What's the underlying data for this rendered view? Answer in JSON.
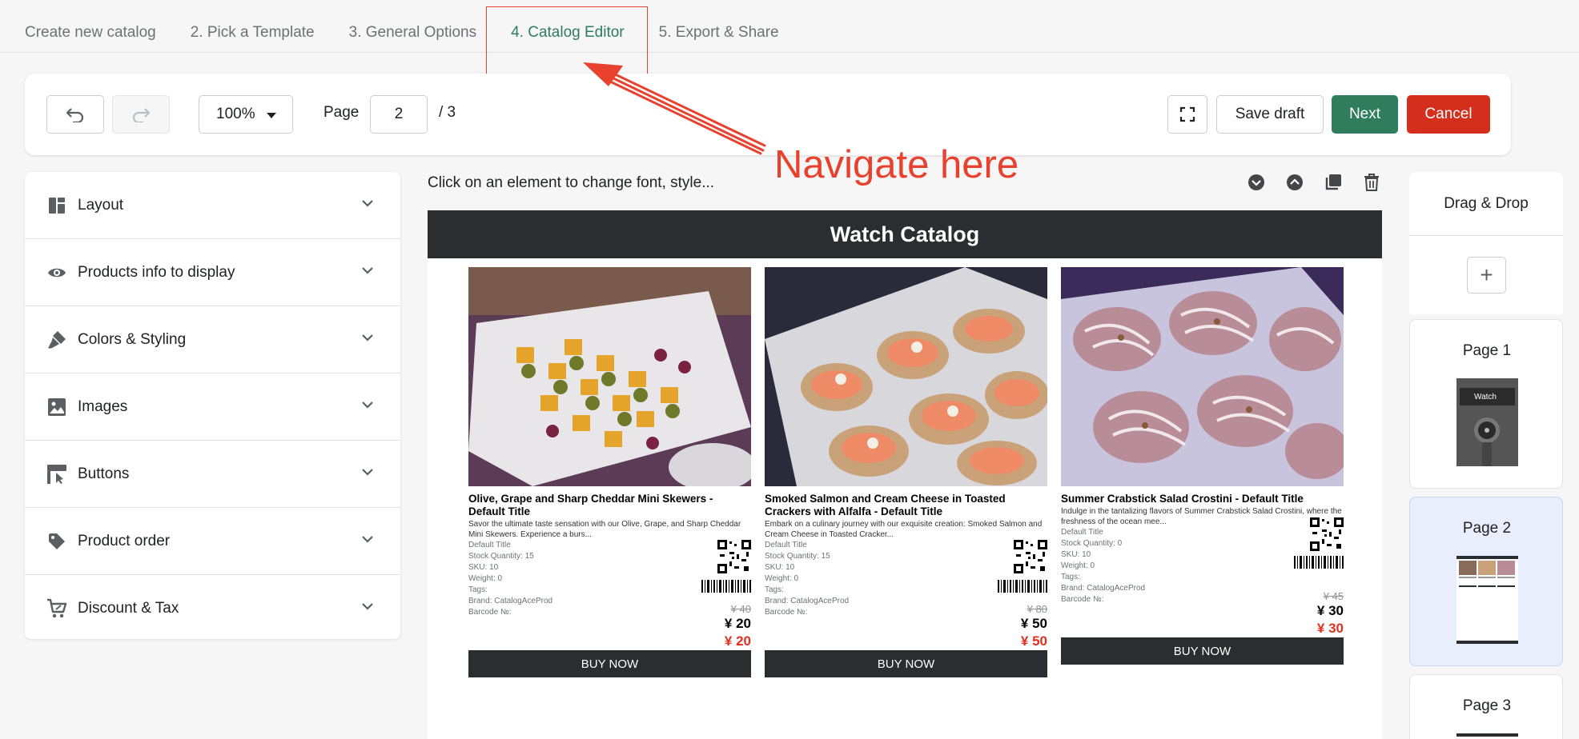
{
  "tabs": [
    {
      "label": "Create new catalog"
    },
    {
      "label": "2. Pick a Template"
    },
    {
      "label": "3. General Options"
    },
    {
      "label": "4. Catalog Editor"
    },
    {
      "label": "5. Export & Share"
    }
  ],
  "active_tab_index": 3,
  "toolbar": {
    "zoom": "100%",
    "page_label": "Page",
    "page_value": "2",
    "page_total": "/ 3",
    "save_draft": "Save draft",
    "next": "Next",
    "cancel": "Cancel"
  },
  "annotation": {
    "text": "Navigate here",
    "color": "#e8412e"
  },
  "sidebar": {
    "items": [
      {
        "label": "Layout",
        "icon": "layout-icon"
      },
      {
        "label": "Products info to display",
        "icon": "eye-icon"
      },
      {
        "label": "Colors & Styling",
        "icon": "paint-brush-icon"
      },
      {
        "label": "Images",
        "icon": "image-icon"
      },
      {
        "label": "Buttons",
        "icon": "button-icon"
      },
      {
        "label": "Product order",
        "icon": "tag-icon"
      },
      {
        "label": "Discount & Tax",
        "icon": "cart-discount-icon"
      }
    ]
  },
  "editor": {
    "hint": "Click on an element to change font, style...",
    "catalog_title": "Watch Catalog",
    "products": [
      {
        "title": "Olive, Grape and Sharp Cheddar Mini Skewers - Default Title",
        "description": "Savor the ultimate taste sensation with our Olive, Grape, and Sharp Cheddar Mini Skewers. Experience a burs...",
        "variant": "Default Title",
        "stock": "Stock Quantity: 15",
        "sku": "SKU: 10",
        "weight": "Weight: 0",
        "tags": "Tags:",
        "brand": "Brand: CatalogAceProd",
        "barcode": "Barcode №:",
        "price_old": "¥ 40",
        "price": "¥ 20",
        "price_discount": "¥ 20",
        "button": "BUY NOW"
      },
      {
        "title": "Smoked Salmon and Cream Cheese in Toasted Crackers with Alfalfa - Default Title",
        "description": "Embark on a culinary journey with our exquisite creation: Smoked Salmon and Cream Cheese in Toasted Cracker...",
        "variant": "Default Title",
        "stock": "Stock Quantity: 15",
        "sku": "SKU: 10",
        "weight": "Weight: 0",
        "tags": "Tags:",
        "brand": "Brand: CatalogAceProd",
        "barcode": "Barcode №:",
        "price_old": "¥ 80",
        "price": "¥ 50",
        "price_discount": "¥ 50",
        "button": "BUY NOW"
      },
      {
        "title": "Summer Crabstick Salad Crostini - Default Title",
        "description": "Indulge in the tantalizing flavors of Summer Crabstick Salad Crostini, where the freshness of the ocean mee...",
        "variant": "Default Title",
        "stock": "Stock Quantity: 0",
        "sku": "SKU: 10",
        "weight": "Weight: 0",
        "tags": "Tags:",
        "brand": "Brand: CatalogAceProd",
        "barcode": "Barcode №:",
        "price_old": "¥ 45",
        "price": "¥ 30",
        "price_discount": "¥ 30",
        "button": "BUY NOW"
      }
    ]
  },
  "pages_panel": {
    "drag_drop": "Drag & Drop",
    "pages": [
      {
        "label": "Page 1",
        "thumb_text": "Watch"
      },
      {
        "label": "Page 2"
      },
      {
        "label": "Page 3"
      }
    ],
    "active_page_index": 1
  },
  "colors": {
    "accent_green": "#2f7d5d",
    "cancel_red": "#d42f1c",
    "annotation_red": "#e8412e",
    "catalog_dark": "#2b2e30",
    "active_page_bg": "#e8eefb"
  }
}
